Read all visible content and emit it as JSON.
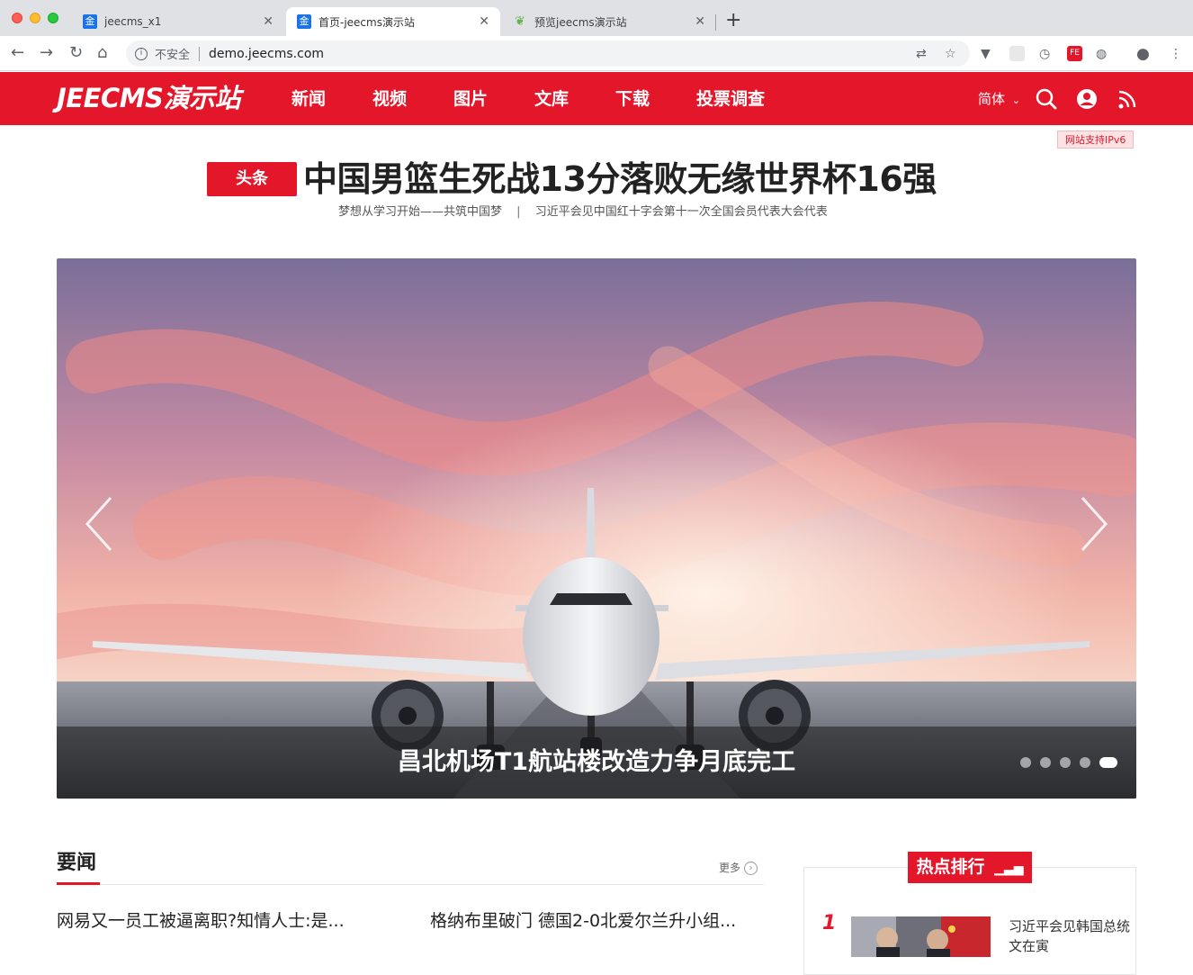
{
  "browser": {
    "tabs": [
      {
        "title": "jeecms_x1",
        "favicon": "金"
      },
      {
        "title": "首页-jeecms演示站",
        "favicon": "金"
      },
      {
        "title": "预览jeecms演示站",
        "favicon": "leaf-icon"
      }
    ],
    "new_tab": "+",
    "security_label": "不安全",
    "url": "demo.jeecms.com",
    "extensions": [
      "FE"
    ]
  },
  "site": {
    "logo": "JEECMS演示站",
    "nav": [
      "新闻",
      "视频",
      "图片",
      "文库",
      "下载",
      "投票调查"
    ],
    "language": "简体",
    "ipv6_badge": "网站支持IPv6",
    "accent_color": "#e3162a"
  },
  "headline": {
    "badge": "头条",
    "title": "中国男篮生死战13分落败无缘世界杯16强",
    "subs": [
      "梦想从学习开始——共筑中国梦",
      "|",
      "习近平会见中国红十字会第十一次全国会员代表大会代表"
    ]
  },
  "carousel": {
    "caption": "昌北机场T1航站楼改造力争月底完工",
    "slide_count": 5,
    "active_slide": 5
  },
  "news_section": {
    "title": "要闻",
    "more": "更多",
    "items": [
      "网易又一员工被逼离职?知情人士:是...",
      "格纳布里破门 德国2-0北爱尔兰升小组..."
    ]
  },
  "hot": {
    "title": "热点排行",
    "items": [
      {
        "rank": "1",
        "title": "习近平会见韩国总统文在寅"
      }
    ]
  }
}
